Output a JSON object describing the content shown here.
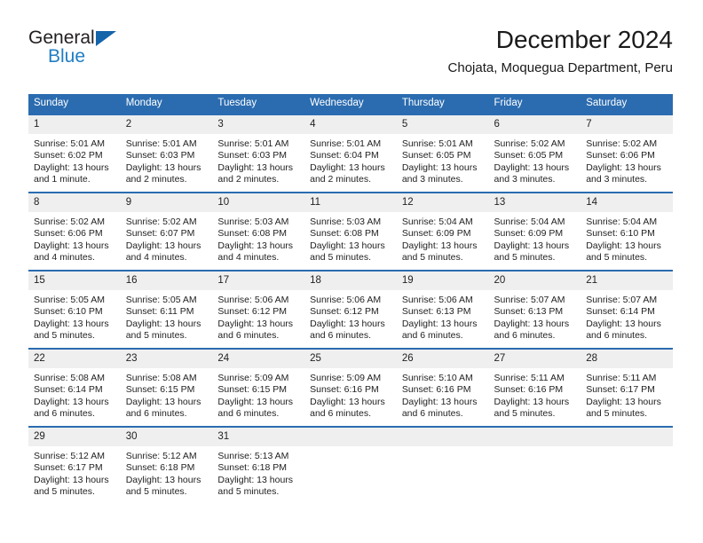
{
  "logo": {
    "word_one": "General",
    "word_two": "Blue",
    "triangle_color": "#1464aa",
    "blue_color": "#1f7ec4"
  },
  "header": {
    "title": "December 2024",
    "subtitle": "Chojata, Moquegua Department, Peru"
  },
  "theme": {
    "header_blue": "#2b6cb0",
    "daynum_gray": "#efefef",
    "text": "#222222"
  },
  "calendar": {
    "weekday_headers": [
      "Sunday",
      "Monday",
      "Tuesday",
      "Wednesday",
      "Thursday",
      "Friday",
      "Saturday"
    ],
    "weeks": [
      [
        {
          "day": "1",
          "sunrise": "Sunrise: 5:01 AM",
          "sunset": "Sunset: 6:02 PM",
          "daylight": "Daylight: 13 hours and 1 minute."
        },
        {
          "day": "2",
          "sunrise": "Sunrise: 5:01 AM",
          "sunset": "Sunset: 6:03 PM",
          "daylight": "Daylight: 13 hours and 2 minutes."
        },
        {
          "day": "3",
          "sunrise": "Sunrise: 5:01 AM",
          "sunset": "Sunset: 6:03 PM",
          "daylight": "Daylight: 13 hours and 2 minutes."
        },
        {
          "day": "4",
          "sunrise": "Sunrise: 5:01 AM",
          "sunset": "Sunset: 6:04 PM",
          "daylight": "Daylight: 13 hours and 2 minutes."
        },
        {
          "day": "5",
          "sunrise": "Sunrise: 5:01 AM",
          "sunset": "Sunset: 6:05 PM",
          "daylight": "Daylight: 13 hours and 3 minutes."
        },
        {
          "day": "6",
          "sunrise": "Sunrise: 5:02 AM",
          "sunset": "Sunset: 6:05 PM",
          "daylight": "Daylight: 13 hours and 3 minutes."
        },
        {
          "day": "7",
          "sunrise": "Sunrise: 5:02 AM",
          "sunset": "Sunset: 6:06 PM",
          "daylight": "Daylight: 13 hours and 3 minutes."
        }
      ],
      [
        {
          "day": "8",
          "sunrise": "Sunrise: 5:02 AM",
          "sunset": "Sunset: 6:06 PM",
          "daylight": "Daylight: 13 hours and 4 minutes."
        },
        {
          "day": "9",
          "sunrise": "Sunrise: 5:02 AM",
          "sunset": "Sunset: 6:07 PM",
          "daylight": "Daylight: 13 hours and 4 minutes."
        },
        {
          "day": "10",
          "sunrise": "Sunrise: 5:03 AM",
          "sunset": "Sunset: 6:08 PM",
          "daylight": "Daylight: 13 hours and 4 minutes."
        },
        {
          "day": "11",
          "sunrise": "Sunrise: 5:03 AM",
          "sunset": "Sunset: 6:08 PM",
          "daylight": "Daylight: 13 hours and 5 minutes."
        },
        {
          "day": "12",
          "sunrise": "Sunrise: 5:04 AM",
          "sunset": "Sunset: 6:09 PM",
          "daylight": "Daylight: 13 hours and 5 minutes."
        },
        {
          "day": "13",
          "sunrise": "Sunrise: 5:04 AM",
          "sunset": "Sunset: 6:09 PM",
          "daylight": "Daylight: 13 hours and 5 minutes."
        },
        {
          "day": "14",
          "sunrise": "Sunrise: 5:04 AM",
          "sunset": "Sunset: 6:10 PM",
          "daylight": "Daylight: 13 hours and 5 minutes."
        }
      ],
      [
        {
          "day": "15",
          "sunrise": "Sunrise: 5:05 AM",
          "sunset": "Sunset: 6:10 PM",
          "daylight": "Daylight: 13 hours and 5 minutes."
        },
        {
          "day": "16",
          "sunrise": "Sunrise: 5:05 AM",
          "sunset": "Sunset: 6:11 PM",
          "daylight": "Daylight: 13 hours and 5 minutes."
        },
        {
          "day": "17",
          "sunrise": "Sunrise: 5:06 AM",
          "sunset": "Sunset: 6:12 PM",
          "daylight": "Daylight: 13 hours and 6 minutes."
        },
        {
          "day": "18",
          "sunrise": "Sunrise: 5:06 AM",
          "sunset": "Sunset: 6:12 PM",
          "daylight": "Daylight: 13 hours and 6 minutes."
        },
        {
          "day": "19",
          "sunrise": "Sunrise: 5:06 AM",
          "sunset": "Sunset: 6:13 PM",
          "daylight": "Daylight: 13 hours and 6 minutes."
        },
        {
          "day": "20",
          "sunrise": "Sunrise: 5:07 AM",
          "sunset": "Sunset: 6:13 PM",
          "daylight": "Daylight: 13 hours and 6 minutes."
        },
        {
          "day": "21",
          "sunrise": "Sunrise: 5:07 AM",
          "sunset": "Sunset: 6:14 PM",
          "daylight": "Daylight: 13 hours and 6 minutes."
        }
      ],
      [
        {
          "day": "22",
          "sunrise": "Sunrise: 5:08 AM",
          "sunset": "Sunset: 6:14 PM",
          "daylight": "Daylight: 13 hours and 6 minutes."
        },
        {
          "day": "23",
          "sunrise": "Sunrise: 5:08 AM",
          "sunset": "Sunset: 6:15 PM",
          "daylight": "Daylight: 13 hours and 6 minutes."
        },
        {
          "day": "24",
          "sunrise": "Sunrise: 5:09 AM",
          "sunset": "Sunset: 6:15 PM",
          "daylight": "Daylight: 13 hours and 6 minutes."
        },
        {
          "day": "25",
          "sunrise": "Sunrise: 5:09 AM",
          "sunset": "Sunset: 6:16 PM",
          "daylight": "Daylight: 13 hours and 6 minutes."
        },
        {
          "day": "26",
          "sunrise": "Sunrise: 5:10 AM",
          "sunset": "Sunset: 6:16 PM",
          "daylight": "Daylight: 13 hours and 6 minutes."
        },
        {
          "day": "27",
          "sunrise": "Sunrise: 5:11 AM",
          "sunset": "Sunset: 6:16 PM",
          "daylight": "Daylight: 13 hours and 5 minutes."
        },
        {
          "day": "28",
          "sunrise": "Sunrise: 5:11 AM",
          "sunset": "Sunset: 6:17 PM",
          "daylight": "Daylight: 13 hours and 5 minutes."
        }
      ],
      [
        {
          "day": "29",
          "sunrise": "Sunrise: 5:12 AM",
          "sunset": "Sunset: 6:17 PM",
          "daylight": "Daylight: 13 hours and 5 minutes."
        },
        {
          "day": "30",
          "sunrise": "Sunrise: 5:12 AM",
          "sunset": "Sunset: 6:18 PM",
          "daylight": "Daylight: 13 hours and 5 minutes."
        },
        {
          "day": "31",
          "sunrise": "Sunrise: 5:13 AM",
          "sunset": "Sunset: 6:18 PM",
          "daylight": "Daylight: 13 hours and 5 minutes."
        },
        {
          "day": "",
          "sunrise": "",
          "sunset": "",
          "daylight": ""
        },
        {
          "day": "",
          "sunrise": "",
          "sunset": "",
          "daylight": ""
        },
        {
          "day": "",
          "sunrise": "",
          "sunset": "",
          "daylight": ""
        },
        {
          "day": "",
          "sunrise": "",
          "sunset": "",
          "daylight": ""
        }
      ]
    ]
  }
}
